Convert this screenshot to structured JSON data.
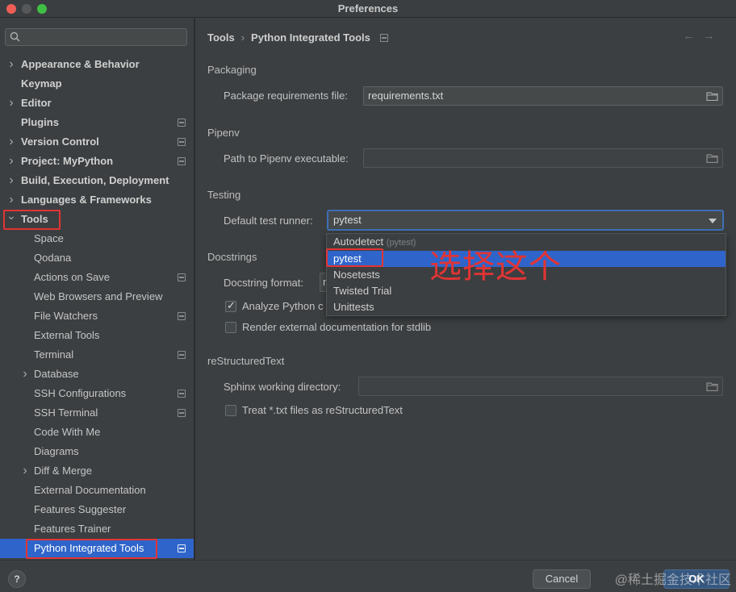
{
  "window": {
    "title": "Preferences"
  },
  "sidebar": {
    "search_placeholder": "",
    "items": [
      {
        "label": "Appearance & Behavior",
        "arrow": ">",
        "level": 0,
        "bold": true,
        "project": false
      },
      {
        "label": "Keymap",
        "arrow": "",
        "level": 0,
        "bold": true,
        "project": false
      },
      {
        "label": "Editor",
        "arrow": ">",
        "level": 0,
        "bold": true,
        "project": false
      },
      {
        "label": "Plugins",
        "arrow": "",
        "level": 0,
        "bold": true,
        "project": true
      },
      {
        "label": "Version Control",
        "arrow": ">",
        "level": 0,
        "bold": true,
        "project": true
      },
      {
        "label": "Project: MyPython",
        "arrow": ">",
        "level": 0,
        "bold": true,
        "project": true
      },
      {
        "label": "Build, Execution, Deployment",
        "arrow": ">",
        "level": 0,
        "bold": true,
        "project": false
      },
      {
        "label": "Languages & Frameworks",
        "arrow": ">",
        "level": 0,
        "bold": true,
        "project": false
      },
      {
        "label": "Tools",
        "arrow": "v",
        "level": 0,
        "bold": true,
        "project": false
      },
      {
        "label": "Space",
        "arrow": "",
        "level": 1,
        "bold": false,
        "project": false
      },
      {
        "label": "Qodana",
        "arrow": "",
        "level": 1,
        "bold": false,
        "project": false
      },
      {
        "label": "Actions on Save",
        "arrow": "",
        "level": 1,
        "bold": false,
        "project": true
      },
      {
        "label": "Web Browsers and Preview",
        "arrow": "",
        "level": 1,
        "bold": false,
        "project": false
      },
      {
        "label": "File Watchers",
        "arrow": "",
        "level": 1,
        "bold": false,
        "project": true
      },
      {
        "label": "External Tools",
        "arrow": "",
        "level": 1,
        "bold": false,
        "project": false
      },
      {
        "label": "Terminal",
        "arrow": "",
        "level": 1,
        "bold": false,
        "project": true
      },
      {
        "label": "Database",
        "arrow": ">",
        "level": 1,
        "bold": false,
        "project": false
      },
      {
        "label": "SSH Configurations",
        "arrow": "",
        "level": 1,
        "bold": false,
        "project": true
      },
      {
        "label": "SSH Terminal",
        "arrow": "",
        "level": 1,
        "bold": false,
        "project": true
      },
      {
        "label": "Code With Me",
        "arrow": "",
        "level": 1,
        "bold": false,
        "project": false
      },
      {
        "label": "Diagrams",
        "arrow": "",
        "level": 1,
        "bold": false,
        "project": false
      },
      {
        "label": "Diff & Merge",
        "arrow": ">",
        "level": 1,
        "bold": false,
        "project": false
      },
      {
        "label": "External Documentation",
        "arrow": "",
        "level": 1,
        "bold": false,
        "project": false
      },
      {
        "label": "Features Suggester",
        "arrow": "",
        "level": 1,
        "bold": false,
        "project": false
      },
      {
        "label": "Features Trainer",
        "arrow": "",
        "level": 1,
        "bold": false,
        "project": false
      },
      {
        "label": "Python Integrated Tools",
        "arrow": "",
        "level": 1,
        "bold": false,
        "project": true,
        "selected": true
      }
    ]
  },
  "breadcrumb": {
    "parent": "Tools",
    "separator": "›",
    "current": "Python Integrated Tools"
  },
  "nav": {
    "back": "←",
    "forward": "→"
  },
  "packaging": {
    "section": "Packaging",
    "requirements_label": "Package requirements file:",
    "requirements_value": "requirements.txt"
  },
  "pipenv": {
    "section": "Pipenv",
    "path_label": "Path to Pipenv executable:",
    "path_value": ""
  },
  "testing": {
    "section": "Testing",
    "runner_label": "Default test runner:",
    "runner_value": "pytest",
    "options": [
      {
        "label": "Autodetect",
        "hint": "(pytest)"
      },
      {
        "label": "pytest",
        "hint": ""
      },
      {
        "label": "Nosetests",
        "hint": ""
      },
      {
        "label": "Twisted Trial",
        "hint": ""
      },
      {
        "label": "Unittests",
        "hint": ""
      }
    ],
    "selected_option": "pytest"
  },
  "docstrings": {
    "section": "Docstrings",
    "format_label": "Docstring format:",
    "format_value_visible": "r",
    "analyze_label": "Analyze Python c",
    "analyze_checked": true,
    "render_label": "Render external documentation for stdlib",
    "render_checked": false
  },
  "restructured": {
    "section": "reStructuredText",
    "sphinx_label": "Sphinx working directory:",
    "sphinx_value": "",
    "treat_label": "Treat *.txt files as reStructuredText",
    "treat_checked": false
  },
  "annotation": {
    "text": "选择这个",
    "color": "#e23434"
  },
  "footer": {
    "help_label": "?",
    "cancel_label": "Cancel",
    "ok_label": "OK",
    "watermark": "@稀土掘金技术社区"
  },
  "colors": {
    "background": "#3c3f41",
    "selection": "#2f65ca",
    "highlight_box": "#e23434"
  }
}
